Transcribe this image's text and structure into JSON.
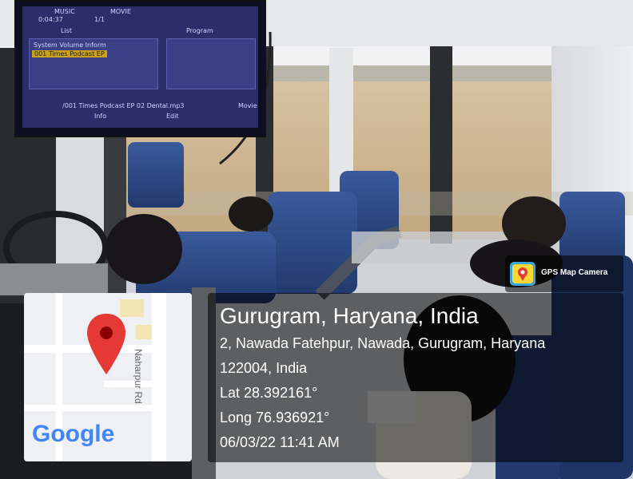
{
  "tv": {
    "tab_music": "MUSIC",
    "tab_movie": "MOVIE",
    "time": "0:04:37",
    "track": "1/1",
    "list_label": "List",
    "program_label": "Program",
    "item_system": "System Volume Inform",
    "item_podcast": "001 Times Podcast EP",
    "now_playing": "/001 Times Podcast EP 02 Dental.mp3",
    "info_label": "Info",
    "edit_label": "Edit",
    "movie_label": "Movie"
  },
  "overlay": {
    "city": "Gurugram, Haryana, India",
    "address_line1": "2, Nawada Fatehpur, Nawada, Gurugram, Haryana",
    "address_line2": "122004, India",
    "lat": "Lat 28.392161°",
    "long": "Long 76.936921°",
    "datetime": "06/03/22 11:41 AM"
  },
  "badge": {
    "label": "GPS Map Camera",
    "icon": "gps-map-camera-icon"
  },
  "map": {
    "road_label": "Naharpur Rd",
    "logo": "Google",
    "pin_icon": "map-pin-icon"
  }
}
